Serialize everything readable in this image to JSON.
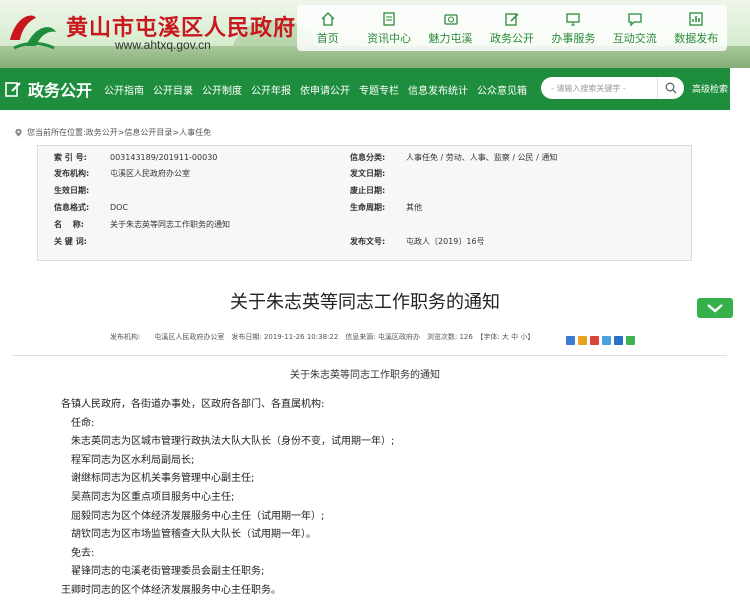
{
  "header": {
    "site_title": "黄山市屯溪区人民政府",
    "site_url": "www.ahtxq.gov.cn",
    "nav": [
      {
        "label": "首页",
        "icon": "home-icon"
      },
      {
        "label": "资讯中心",
        "icon": "document-icon"
      },
      {
        "label": "魅力屯溪",
        "icon": "camera-icon"
      },
      {
        "label": "政务公开",
        "icon": "edit-icon"
      },
      {
        "label": "办事服务",
        "icon": "monitor-icon"
      },
      {
        "label": "互动交流",
        "icon": "chat-icon"
      },
      {
        "label": "数据发布",
        "icon": "chart-icon"
      }
    ]
  },
  "section_bar": {
    "title": "政务公开",
    "links": [
      "公开指南",
      "公开目录",
      "公开制度",
      "公开年报",
      "依申请公开",
      "专题专栏",
      "信息发布统计",
      "公众意见箱"
    ],
    "search_placeholder": "- 请输入搜索关键字 -",
    "advanced_search": "高级检索",
    "accent": "#1e8e3e"
  },
  "breadcrumb": {
    "prefix": "您当前所在位置:",
    "items": [
      "政务公开",
      "信息公开目录",
      "人事任免"
    ],
    "sep": " > "
  },
  "meta": {
    "index_no_label": "索 引 号:",
    "index_no": "003143189/201911-00030",
    "category_label": "信息分类:",
    "category": "人事任免 / 劳动、人事、监察 / 公民 / 通知",
    "publisher_label": "发布机构:",
    "publisher": "屯溪区人民政府办公室",
    "pub_date_label": "发文日期:",
    "pub_date": "",
    "effective_label": "生效日期:",
    "effective": "",
    "repeal_label": "废止日期:",
    "repeal": "",
    "format_label": "信息格式:",
    "format": "DOC",
    "lifecycle_label": "生命周期:",
    "lifecycle": "其他",
    "name_label": "名　 称:",
    "name": "关于朱志英等同志工作职务的通知",
    "keywords_label": "关 键 词:",
    "keywords": "",
    "doc_no_label": "发布文号:",
    "doc_no": "屯政人〔2019〕16号"
  },
  "article": {
    "title": "关于朱志英等同志工作职务的通知",
    "info_line": "发布机构:　　屯溪区人民政府办公室　发布日期: 2019-11-26 10:38:22　信息来源: 屯溪区政府办　浏览次数: 126　【字体: 大 中 小】",
    "subtitle": "关于朱志英等同志工作职务的通知",
    "body": [
      "各镇人民政府，各街道办事处，区政府各部门、各直属机构:",
      "　任命:",
      "　朱志英同志为区城市管理行政执法大队大队长（身份不变，试用期一年）;",
      "　程军同志为区水利局副局长;",
      "　谢继标同志为区机关事务管理中心副主任;",
      "　吴燕同志为区重点项目服务中心主任;",
      "　屈毅同志为区个体经济发展服务中心主任（试用期一年）;",
      "　胡钦同志为区市场监管稽查大队大队长（试用期一年）。",
      "　免去:",
      "　翟锋同志的屯溪老街管理委员会副主任职务;",
      "王卿时同志的区个体经济发展服务中心主任职务。"
    ]
  }
}
